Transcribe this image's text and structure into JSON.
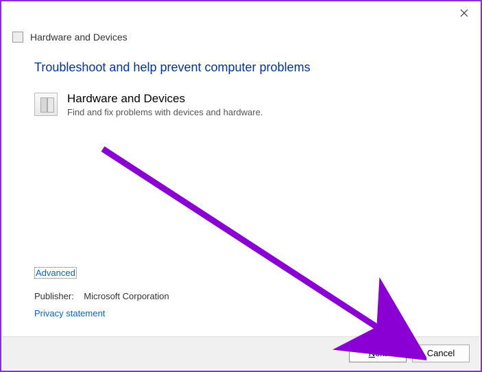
{
  "window": {
    "title": "Hardware and Devices"
  },
  "content": {
    "heading": "Troubleshoot and help prevent computer problems",
    "item_title": "Hardware and Devices",
    "item_desc": "Find and fix problems with devices and hardware."
  },
  "links": {
    "advanced": "Advanced",
    "publisher_label": "Publisher:",
    "publisher_value": "Microsoft Corporation",
    "privacy": "Privacy statement"
  },
  "buttons": {
    "next_prefix": "N",
    "next_rest": "ext",
    "cancel": "Cancel"
  },
  "annotation": {
    "arrow_color": "#8a00d4"
  }
}
